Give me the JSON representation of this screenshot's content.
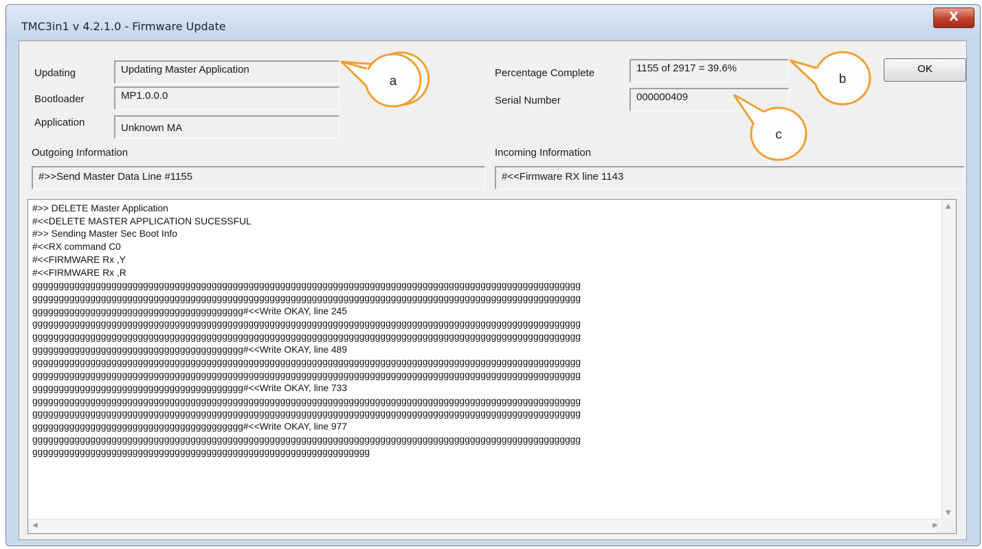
{
  "window": {
    "title": "TMC3in1 v 4.2.1.0  -  Firmware Update",
    "close_label": "X"
  },
  "fields": {
    "updating_label": "Updating",
    "updating_value": "Updating Master Application",
    "bootloader_label": "Bootloader",
    "bootloader_value": "MP1.0.0.0",
    "application_label": "Application",
    "application_value": "Unknown MA",
    "percentage_label": "Percentage Complete",
    "percentage_value": "1155 of 2917 = 39.6%",
    "serial_label": "Serial Number",
    "serial_value": "000000409",
    "outgoing_label": "Outgoing Information",
    "outgoing_value": "#>>Send Master Data Line #1155",
    "incoming_label": "Incoming Information",
    "incoming_value": "#<<Firmware RX line 1143"
  },
  "ok_button": "OK",
  "callouts": {
    "a": "a",
    "b": "b",
    "c": "c"
  },
  "log_lines": [
    "#>> DELETE Master Application",
    "#<<DELETE MASTER APPLICATION SUCESSFUL",
    "#>> Sending Master Sec Boot Info",
    "#<<RX command C0",
    "#<<FIRMWARE Rx ,Y",
    "#<<FIRMWARE Rx ,R",
    "gggggggggggggggggggggggggggggggggggggggggggggggggggggggggggggggggggggggggggggggggggggggggggggggggggggggg",
    "gggggggggggggggggggggggggggggggggggggggggggggggggggggggggggggggggggggggggggggggggggggggggggggggggggggggg",
    "gggggggggggggggggggggggggggggggggggggggg#<<Write OKAY, line 245",
    "gggggggggggggggggggggggggggggggggggggggggggggggggggggggggggggggggggggggggggggggggggggggggggggggggggggggg",
    "gggggggggggggggggggggggggggggggggggggggggggggggggggggggggggggggggggggggggggggggggggggggggggggggggggggggg",
    "gggggggggggggggggggggggggggggggggggggggg#<<Write OKAY, line 489",
    "gggggggggggggggggggggggggggggggggggggggggggggggggggggggggggggggggggggggggggggggggggggggggggggggggggggggg",
    "gggggggggggggggggggggggggggggggggggggggggggggggggggggggggggggggggggggggggggggggggggggggggggggggggggggggg",
    "gggggggggggggggggggggggggggggggggggggggg#<<Write OKAY, line 733",
    "gggggggggggggggggggggggggggggggggggggggggggggggggggggggggggggggggggggggggggggggggggggggggggggggggggggggg",
    "gggggggggggggggggggggggggggggggggggggggggggggggggggggggggggggggggggggggggggggggggggggggggggggggggggggggg",
    "gggggggggggggggggggggggggggggggggggggggg#<<Write OKAY, line 977",
    "gggggggggggggggggggggggggggggggggggggggggggggggggggggggggggggggggggggggggggggggggggggggggggggggggggggggg",
    "gggggggggggggggggggggggggggggggggggggggggggggggggggggggggggggggg"
  ],
  "colors": {
    "callout_stroke": "#f0a030",
    "close_button": "#c0402a",
    "dialog_bg": "#f0f0f0"
  }
}
